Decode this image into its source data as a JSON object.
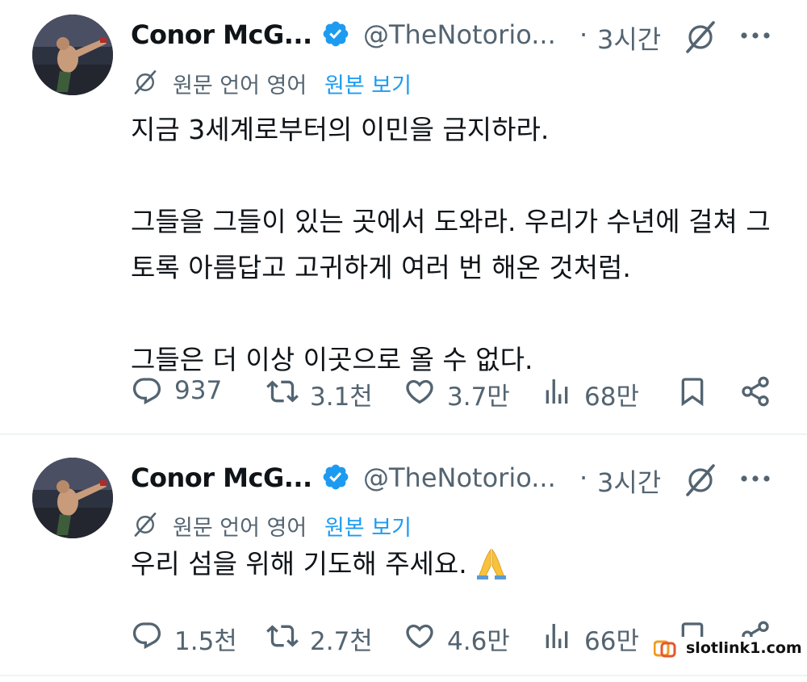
{
  "tweets": [
    {
      "author": {
        "name": "Conor McG...",
        "handle": "@TheNotorio...",
        "verified": true
      },
      "dot": "·",
      "time": "3시간",
      "translation": {
        "language_label": "원문 언어 영어",
        "link_label": "원본 보기"
      },
      "paragraphs": [
        "지금 3세계로부터의 이민을 금지하라.",
        "그들을 그들이 있는 곳에서 도와라. 우리가 수년에 걸쳐 그",
        "토록 아름답고 고귀하게 여러 번 해온 것처럼.",
        "그들은 더 이상 이곳으로 올 수 없다."
      ],
      "stats": {
        "replies": "937",
        "retweets": "3.1천",
        "likes": "3.7만",
        "views": "68만"
      }
    },
    {
      "author": {
        "name": "Conor McG...",
        "handle": "@TheNotorio...",
        "verified": true
      },
      "dot": "·",
      "time": "3시간",
      "translation": {
        "language_label": "원문 언어 영어",
        "link_label": "원본 보기"
      },
      "paragraphs": [
        "우리 섬을 위해 기도해 주세요."
      ],
      "emoji": "folded-hands",
      "stats": {
        "replies": "1.5천",
        "retweets": "2.7천",
        "likes": "4.6만",
        "views": "66만"
      }
    }
  ],
  "colors": {
    "text": "#0f1419",
    "secondary": "#536471",
    "link": "#1d9bf0",
    "verified": "#1d9bf0"
  },
  "icons": [
    "verified-badge-icon",
    "grok-translate-icon",
    "more-icon",
    "reply-icon",
    "retweet-icon",
    "like-icon",
    "views-icon",
    "bookmark-icon",
    "share-icon"
  ],
  "watermark": {
    "text": "slotlink1.com"
  }
}
